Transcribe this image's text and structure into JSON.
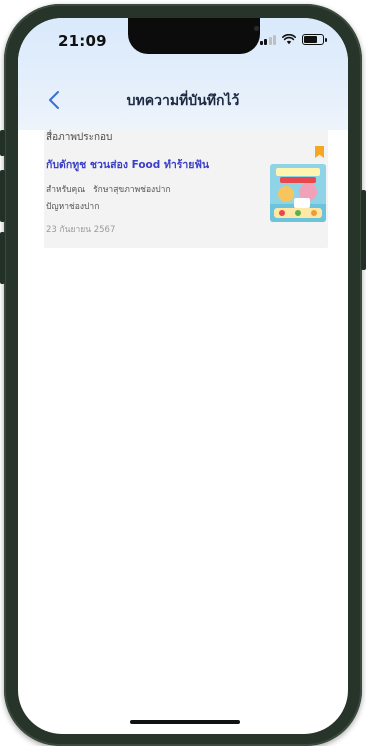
{
  "status_bar": {
    "time": "21:09"
  },
  "nav": {
    "title": "บทความที่บันทึกไว้"
  },
  "saved_articles": [
    {
      "category": "สื่อภาพประกอบ",
      "title": "กับดักทูช ชวนส่อง Food ทำร้ายฟัน",
      "tags": [
        "สำหรับคุณ",
        "รักษาสุขภาพช่องปาก"
      ],
      "tag_line2": "ปัญหาช่องปาก",
      "date": "23 กันยายน 2567"
    }
  ],
  "colors": {
    "accent": "#3b3fc7",
    "bookmark": "#f5a623",
    "header_gradient_top": "#d9e9fb"
  },
  "icons": {
    "back": "chevron-left-icon",
    "bookmark": "bookmark-icon",
    "signal": "cellular-signal-icon",
    "wifi": "wifi-icon",
    "battery": "battery-icon"
  }
}
